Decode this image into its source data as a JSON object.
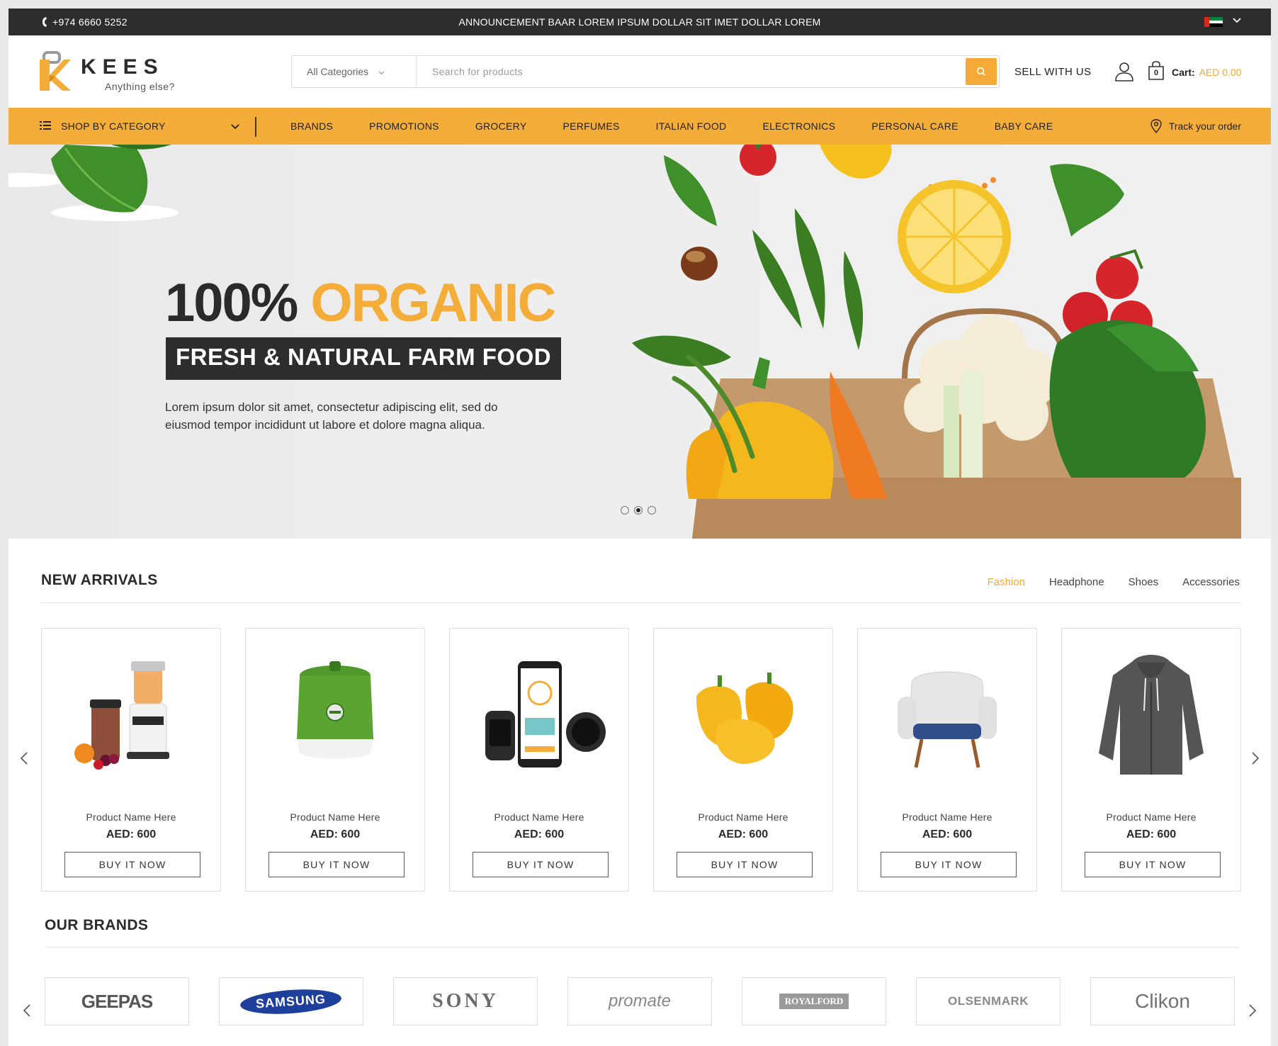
{
  "topbar": {
    "phone": "+974 6660 5252",
    "announcement": "ANNOUNCEMENT BAAR LOREM IPSUM DOLLAR SIT IMET DOLLAR LOREM"
  },
  "header": {
    "logo_name": "KEES",
    "logo_tagline": "Anything else?",
    "category_select": "All Categories",
    "search_placeholder": "Search for products",
    "sell_link": "SELL WITH US",
    "cart_count": "0",
    "cart_label": "Cart:",
    "cart_amount": "AED 0.00"
  },
  "nav": {
    "shop_by_category": "SHOP BY CATEGORY",
    "links": [
      "BRANDS",
      "PROMOTIONS",
      "GROCERY",
      "PERFUMES",
      "ITALIAN FOOD",
      "ELECTRONICS",
      "PERSONAL CARE",
      "BABY CARE"
    ],
    "track_order": "Track your order"
  },
  "hero": {
    "title_part1": "100%",
    "title_part2": "ORGANIC",
    "subtitle": "FRESH & NATURAL FARM FOOD",
    "text": "Lorem ipsum dolor sit amet, consectetur adipiscing elit, sed do eiusmod tempor incididunt ut labore et dolore magna aliqua.",
    "slides": 3,
    "active_slide": 2
  },
  "new_arrivals": {
    "title": "NEW ARRIVALS",
    "tabs": [
      "Fashion",
      "Headphone",
      "Shoes",
      "Accessories"
    ],
    "active_tab": "Fashion",
    "products": [
      {
        "name": "Product Name Here",
        "price": "AED: 600",
        "button": "BUY IT NOW",
        "image": "blender"
      },
      {
        "name": "Product Name Here",
        "price": "AED: 600",
        "button": "BUY IT NOW",
        "image": "rice-cooker"
      },
      {
        "name": "Product Name Here",
        "price": "AED: 600",
        "button": "BUY IT NOW",
        "image": "smartphone-watches"
      },
      {
        "name": "Product Name Here",
        "price": "AED: 600",
        "button": "BUY IT NOW",
        "image": "yellow-peppers"
      },
      {
        "name": "Product Name Here",
        "price": "AED: 600",
        "button": "BUY IT NOW",
        "image": "armchair"
      },
      {
        "name": "Product Name Here",
        "price": "AED: 600",
        "button": "BUY IT NOW",
        "image": "hoodie"
      }
    ]
  },
  "brands": {
    "title": "OUR BRANDS",
    "items": [
      "GEEPAS",
      "SAMSUNG",
      "SONY",
      "promate",
      "ROYALFORD",
      "OLSENMARK",
      "Clikon"
    ]
  },
  "colors": {
    "accent": "#f5ad3a",
    "dark": "#2d2d2d",
    "text": "#2b2b2b"
  }
}
